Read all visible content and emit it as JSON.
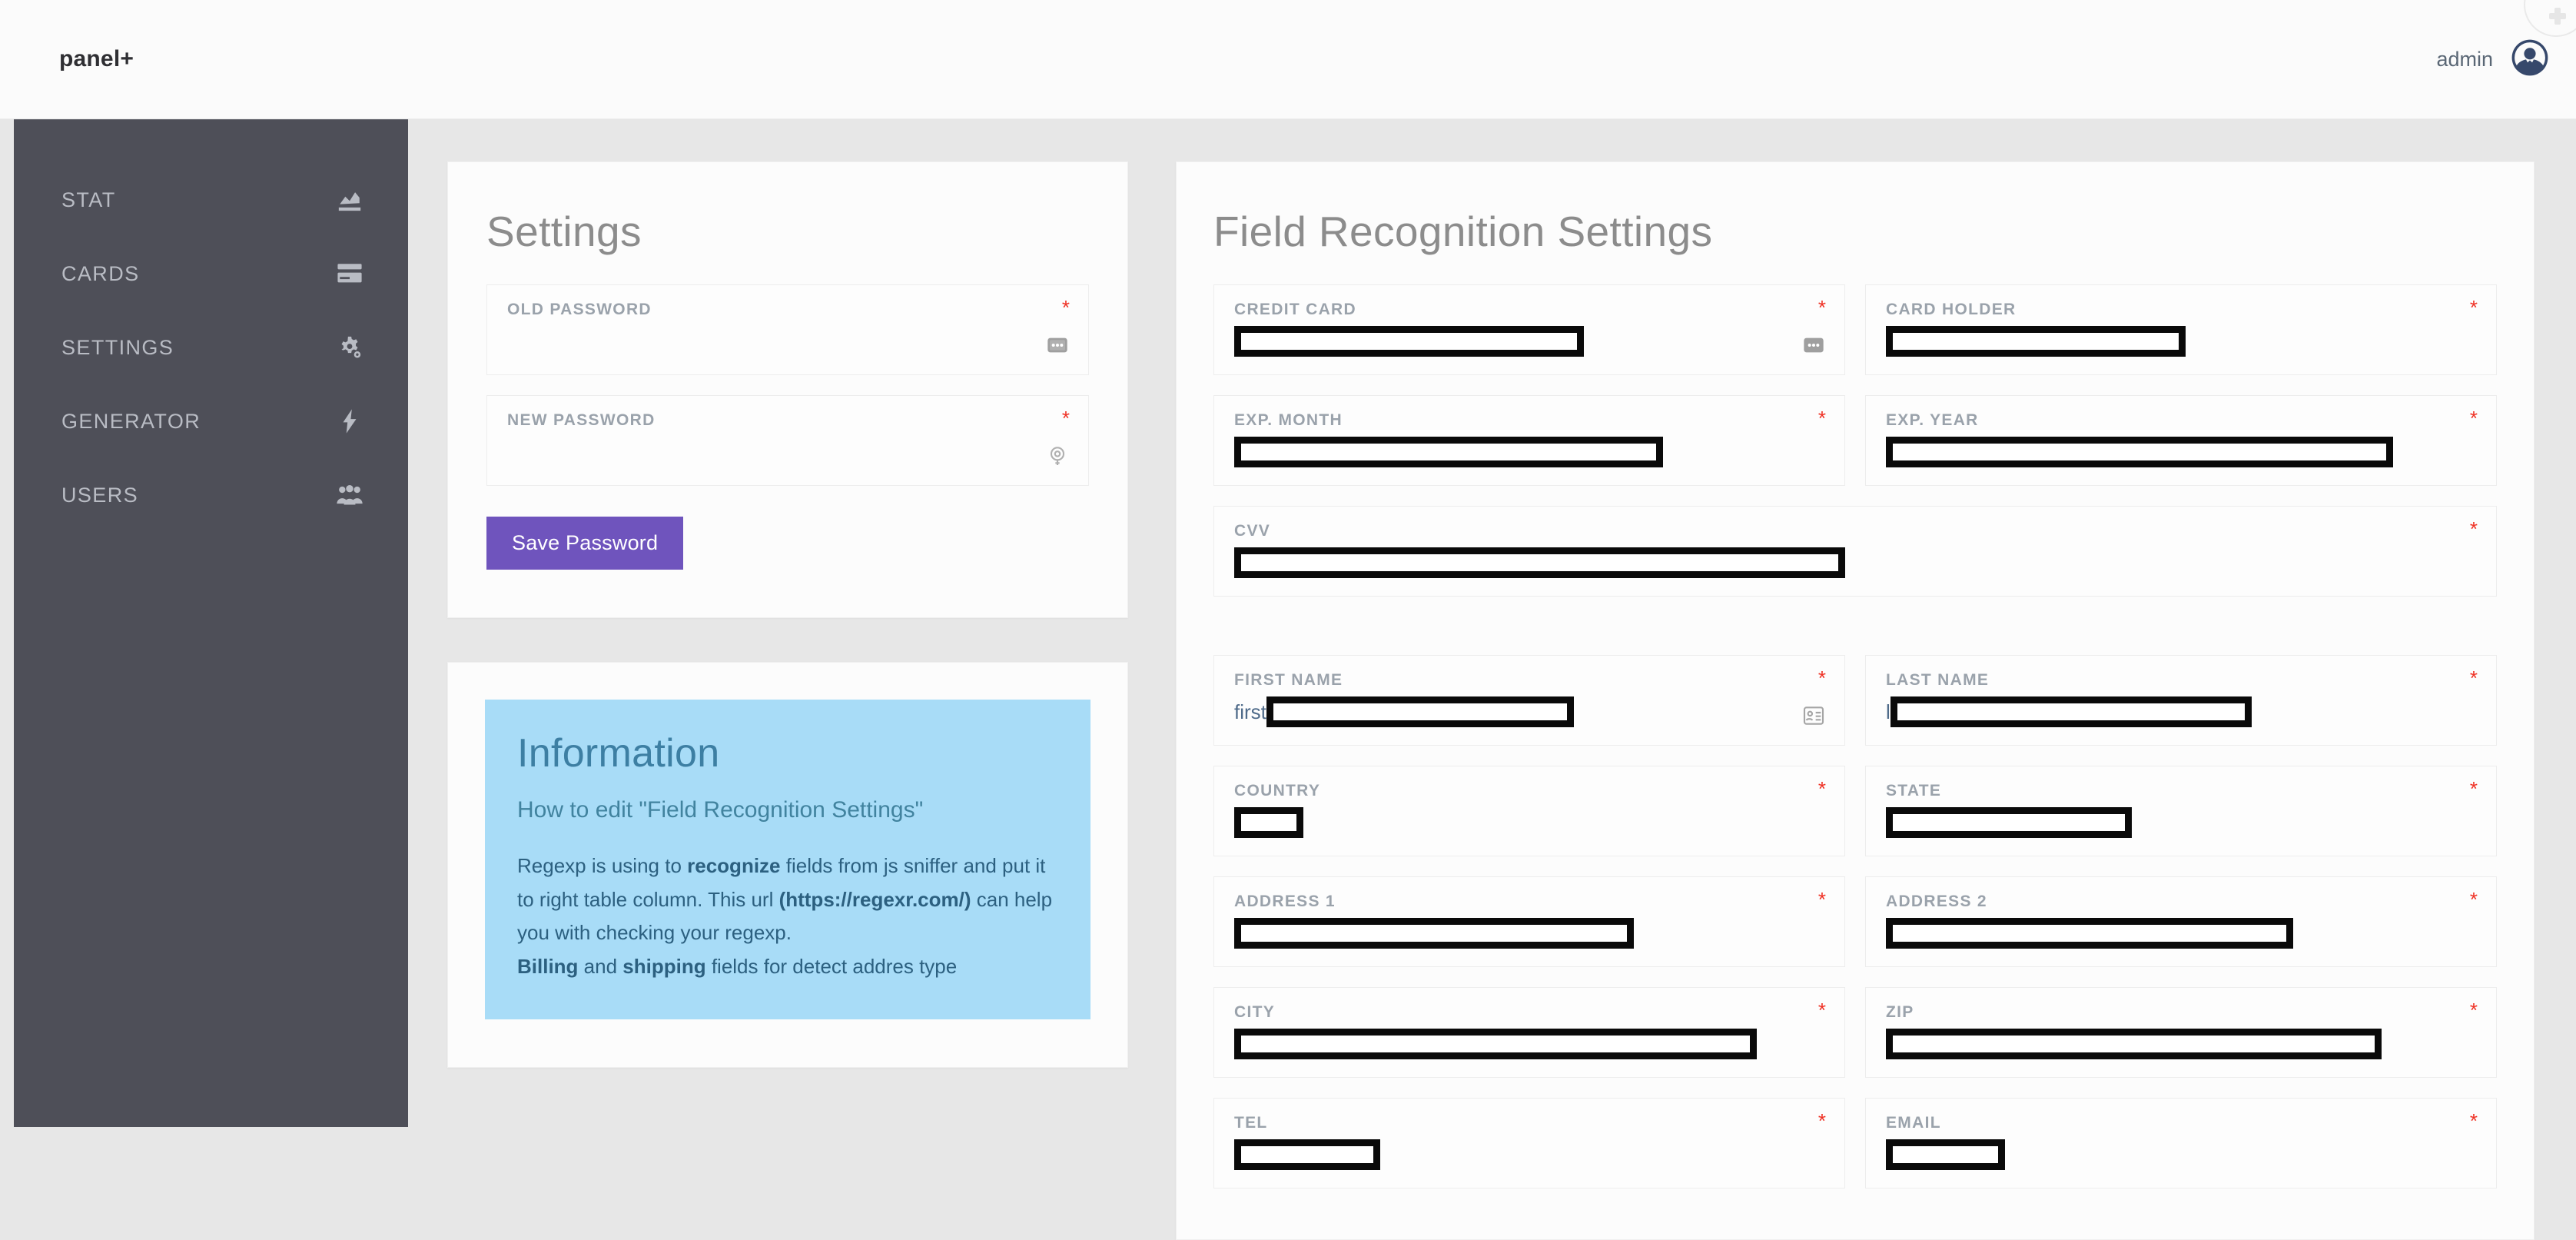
{
  "brand": "panel+",
  "topbar": {
    "admin_label": "admin",
    "avatar_icon": "user-avatar-icon",
    "corner_icon": "gear-icon"
  },
  "sidebar": {
    "items": [
      {
        "label": "STAT",
        "icon": "chart-bar-icon"
      },
      {
        "label": "CARDS",
        "icon": "credit-card-icon"
      },
      {
        "label": "SETTINGS",
        "icon": "gears-icon"
      },
      {
        "label": "GENERATOR",
        "icon": "lightning-bolt-icon"
      },
      {
        "label": "USERS",
        "icon": "users-icon"
      }
    ]
  },
  "settings_card": {
    "title": "Settings",
    "fields": [
      {
        "label": "OLD PASSWORD",
        "required_marker": "*",
        "value": "",
        "icon": "password-dots-icon",
        "redaction_width": 0
      },
      {
        "label": "NEW PASSWORD",
        "required_marker": "*",
        "value": "",
        "icon": "key-circle-icon",
        "redaction_width": 0
      }
    ],
    "save_label": "Save Password"
  },
  "information_card": {
    "title": "Information",
    "subtitle": "How to edit \"Field Recognition Settings\"",
    "paragraph_1_a": "Regexp is using to ",
    "paragraph_1_b": "recognize",
    "paragraph_1_c": " fields from js sniffer and put it to right table column. This url ",
    "paragraph_1_url": "(https://regexr.com/)",
    "paragraph_1_d": " can help you with checking your regexp.",
    "paragraph_2_a": "Billing",
    "paragraph_2_b": " and ",
    "paragraph_2_c": "shipping",
    "paragraph_2_d": " fields for detect addres type"
  },
  "field_recognition_card": {
    "title": "Field Recognition Settings",
    "required_marker": "*",
    "fields": [
      {
        "label": "CREDIT CARD",
        "value": "",
        "prefix": "",
        "icon": "password-dots-icon",
        "redaction_width": 455,
        "full": false
      },
      {
        "label": "CARD HOLDER",
        "value": "",
        "prefix": "",
        "icon": "",
        "redaction_width": 390,
        "full": false
      },
      {
        "label": "EXP. MONTH",
        "value": "",
        "prefix": "",
        "icon": "",
        "redaction_width": 558,
        "full": false
      },
      {
        "label": "EXP. YEAR",
        "value": "",
        "prefix": "",
        "icon": "",
        "redaction_width": 660,
        "full": false
      },
      {
        "label": "CVV",
        "value": "",
        "prefix": "",
        "icon": "",
        "redaction_width": 795,
        "full": true
      },
      {
        "label": "FIRST NAME",
        "value": "",
        "prefix": "first",
        "icon": "contact-card-icon",
        "redaction_width": 400,
        "full": false
      },
      {
        "label": "LAST NAME",
        "value": "",
        "prefix": "l",
        "icon": "",
        "redaction_width": 470,
        "full": false
      },
      {
        "label": "COUNTRY",
        "value": "",
        "prefix": "",
        "icon": "",
        "redaction_width": 90,
        "full": false
      },
      {
        "label": "STATE",
        "value": "",
        "prefix": "",
        "icon": "",
        "redaction_width": 320,
        "full": false
      },
      {
        "label": "ADDRESS 1",
        "value": "",
        "prefix": "",
        "icon": "",
        "redaction_width": 520,
        "full": false
      },
      {
        "label": "ADDRESS 2",
        "value": "",
        "prefix": "",
        "icon": "",
        "redaction_width": 530,
        "full": false
      },
      {
        "label": "CITY",
        "value": "",
        "prefix": "",
        "icon": "",
        "redaction_width": 680,
        "full": false
      },
      {
        "label": "ZIP",
        "value": "",
        "prefix": "",
        "icon": "",
        "redaction_width": 645,
        "full": false
      },
      {
        "label": "TEL",
        "value": "",
        "prefix": "",
        "icon": "",
        "redaction_width": 190,
        "full": false
      },
      {
        "label": "EMAIL",
        "value": "",
        "prefix": "",
        "icon": "",
        "redaction_width": 155,
        "full": false
      }
    ]
  },
  "colors": {
    "sidebar": "#4e4f58",
    "page_background": "#e7e7e7",
    "accent_purple": "#6f54bd",
    "info_panel": "#a8dcf7",
    "required_red": "#ef3124",
    "redaction_black": "#0a0a0a"
  }
}
